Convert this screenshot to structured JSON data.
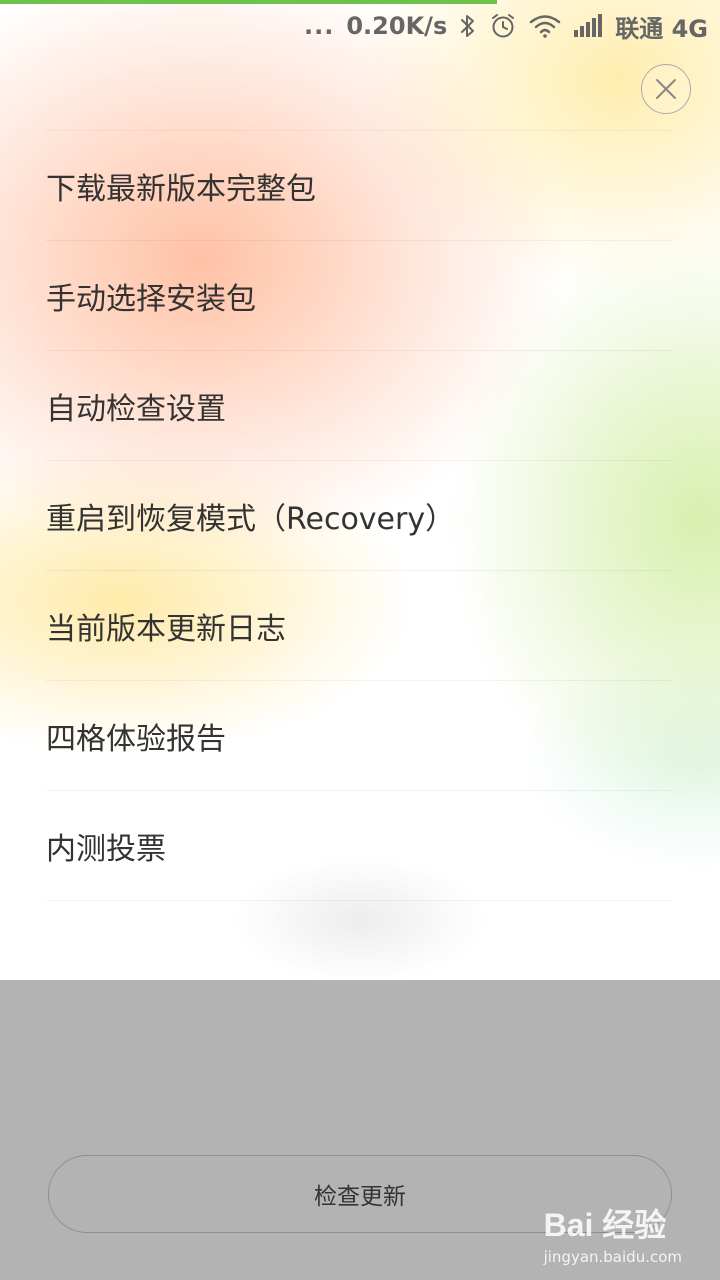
{
  "status_bar": {
    "dots": "...",
    "speed": "0.20K/s",
    "carrier": "联通 4G",
    "icons": [
      "bluetooth-icon",
      "alarm-icon",
      "wifi-icon",
      "signal-icon"
    ]
  },
  "progress": {
    "fraction": 0.69,
    "color": "#6cc24a"
  },
  "menu": {
    "items": [
      {
        "label": "下载最新版本完整包"
      },
      {
        "label": "手动选择安装包"
      },
      {
        "label": "自动检查设置"
      },
      {
        "label": "重启到恢复模式（Recovery）"
      },
      {
        "label": "当前版本更新日志"
      },
      {
        "label": "四格体验报告"
      },
      {
        "label": "内测投票"
      }
    ]
  },
  "footer": {
    "check_button_label": "检查更新"
  },
  "watermark": {
    "logo": "Bai 经验",
    "url": "jingyan.baidu.com"
  }
}
